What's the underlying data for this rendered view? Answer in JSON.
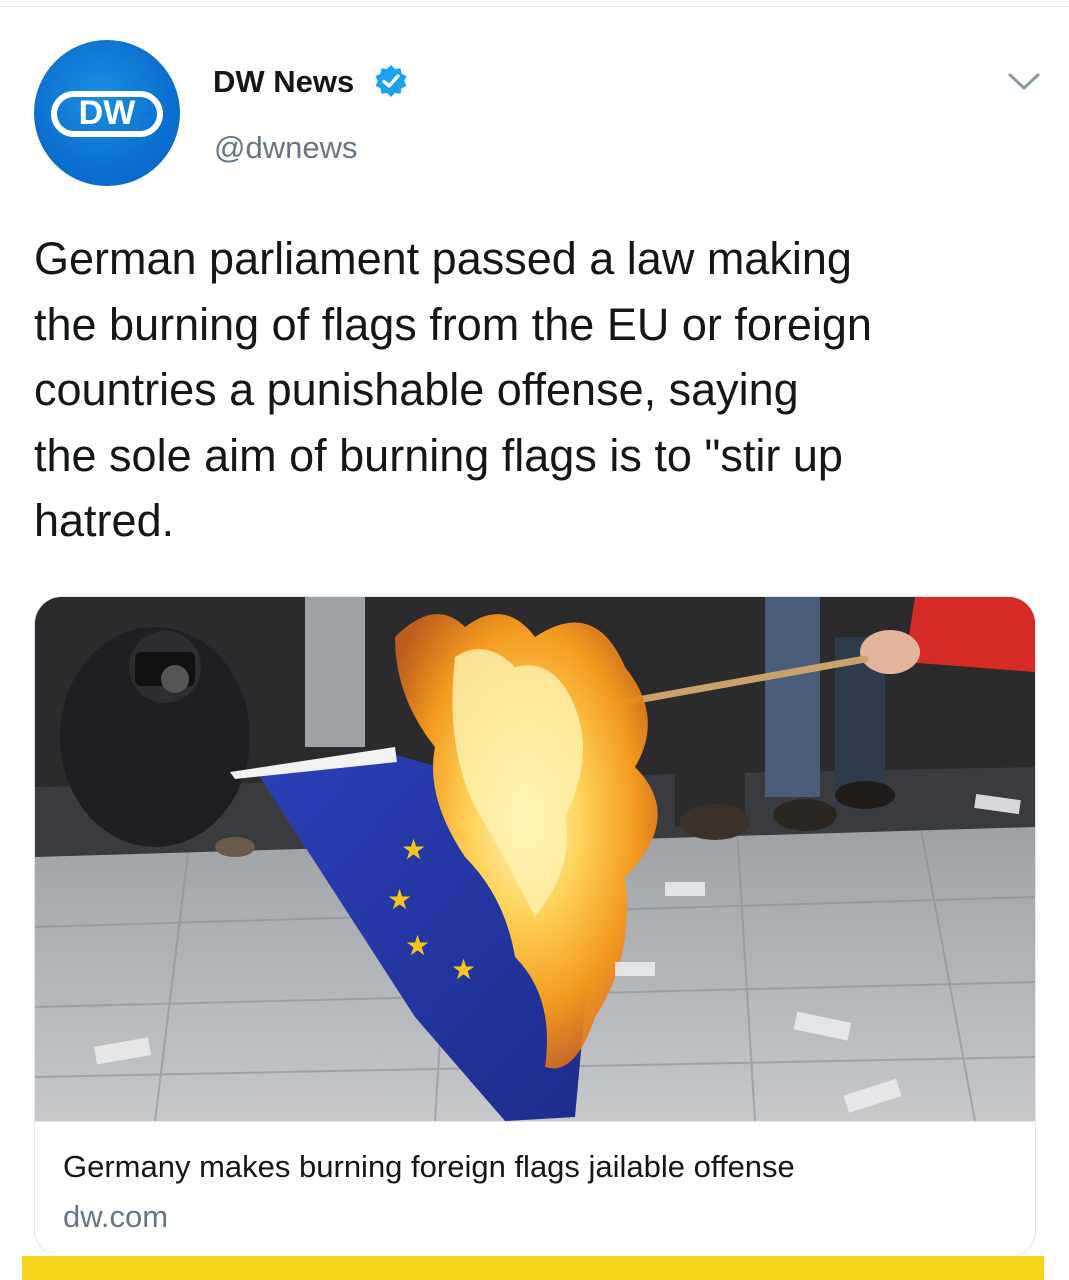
{
  "tweet": {
    "author": {
      "name": "DW News",
      "handle": "@dwnews",
      "verified": true,
      "avatar_text": "DW",
      "avatar_color": "#0a6fd0",
      "verified_color": "#1da1f2"
    },
    "text_lines": [
      "German parliament passed a law making",
      "the burning of flags from the EU or foreign",
      "countries a punishable offense, saying",
      "the sole aim of burning flags is to \"stir up",
      "hatred."
    ],
    "card": {
      "title": "Germany makes burning foreign flags jailable offense",
      "domain": "dw.com",
      "image_alt": "burning-eu-flag-photo"
    },
    "menu_icon": "chevron-down-icon"
  },
  "colors": {
    "text": "#14171a",
    "secondary": "#657786",
    "border": "#e1e8ed",
    "accent_bar": "#f7d51d"
  }
}
